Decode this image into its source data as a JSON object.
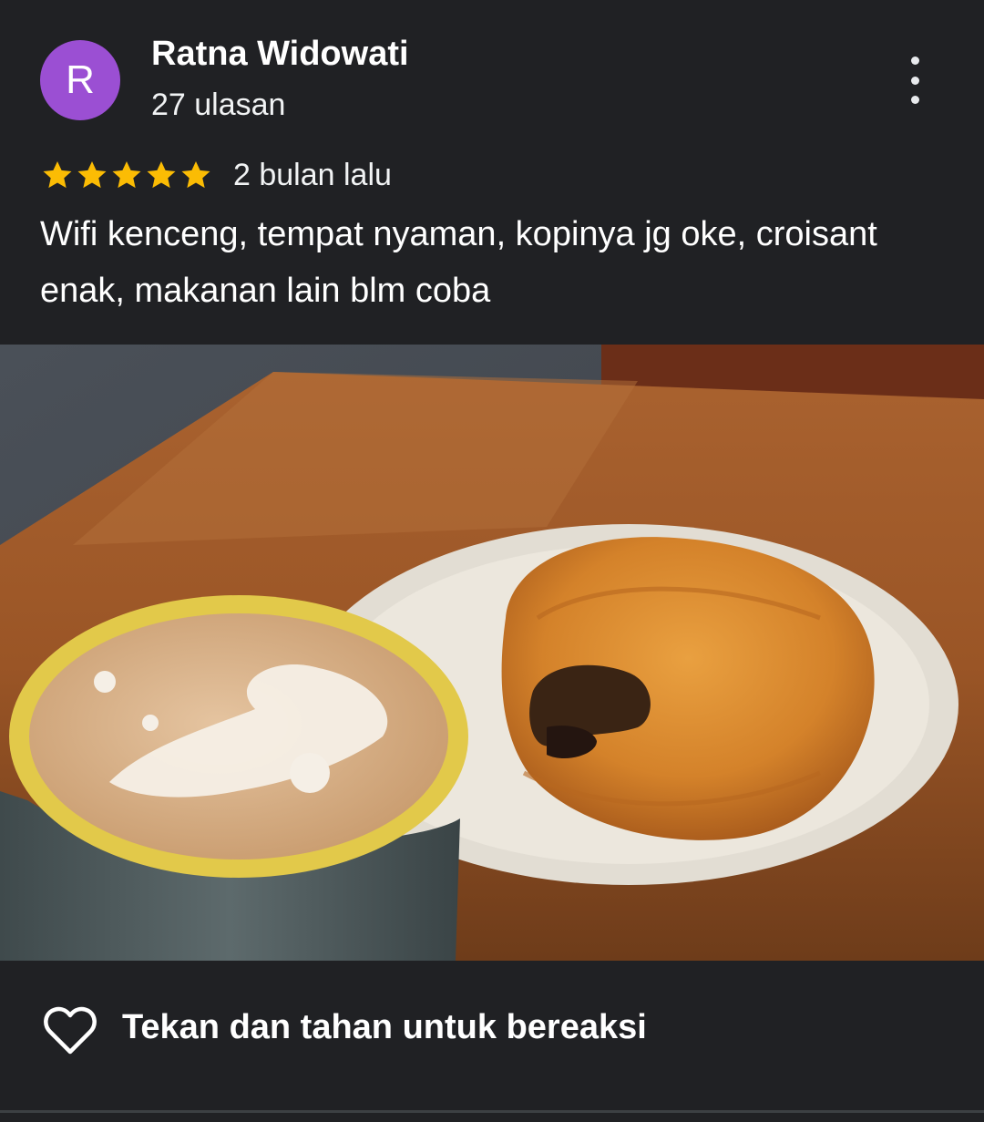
{
  "reviewer": {
    "initial": "R",
    "name": "Ratna Widowati",
    "review_count": "27 ulasan",
    "avatar_color": "#9b4fd3"
  },
  "review": {
    "rating": 5,
    "max_rating": 5,
    "date": "2 bulan lalu",
    "text": "Wifi kenceng, tempat nyaman, kopinya jg oke, croisant enak, makanan lain blm coba"
  },
  "actions": {
    "more_icon": "more-vert-icon",
    "heart_icon": "heart-outline-icon",
    "react_label": "Tekan dan tahan untuk bereaksi"
  },
  "colors": {
    "background": "#202124",
    "star": "#fbbc04"
  }
}
